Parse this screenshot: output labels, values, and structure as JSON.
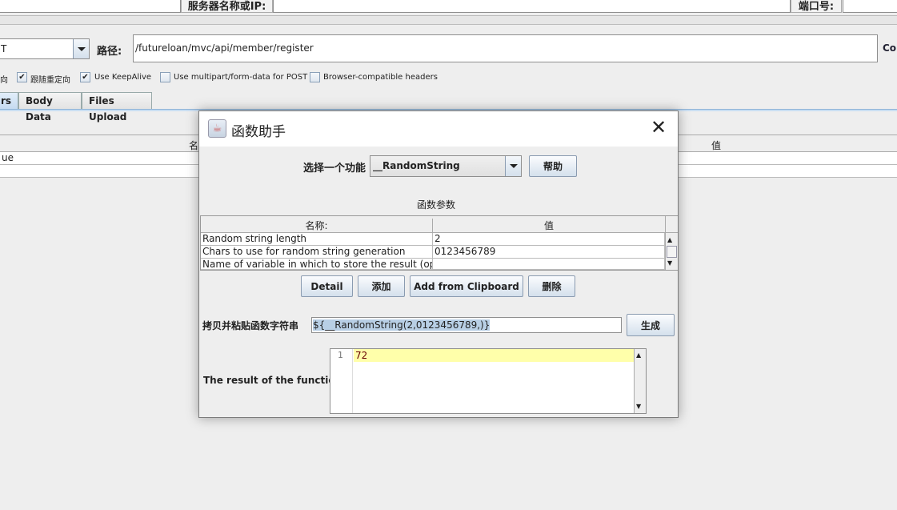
{
  "top": {
    "server_label": "服务器名称或IP:",
    "port_label": "端口号:",
    "server_value": "",
    "port_value": ""
  },
  "request": {
    "method_value": "T",
    "path_label": "路径:",
    "path_value": "/futureloan/mvc/api/member/register",
    "content_label_partial": "Cor"
  },
  "options": [
    {
      "label": "向",
      "checked": null
    },
    {
      "label": "跟随重定向",
      "checked": true
    },
    {
      "label": "Use KeepAlive",
      "checked": true
    },
    {
      "label": "Use multipart/form-data for POST",
      "checked": false
    },
    {
      "label": "Browser-compatible headers",
      "checked": false
    }
  ],
  "tabs": [
    {
      "label": "rs",
      "selected": true
    },
    {
      "label": "Body Data",
      "selected": false
    },
    {
      "label": "Files Upload",
      "selected": false
    }
  ],
  "bg_table": {
    "col_name": "名",
    "col_value": "值",
    "rows": [
      "ue",
      ""
    ]
  },
  "dialog": {
    "title": "函数助手",
    "select_label": "选择一个功能",
    "function_value": "__RandomString",
    "help_button": "帮助",
    "params_title": "函数参数",
    "table": {
      "headers": [
        "名称:",
        "值"
      ],
      "rows": [
        [
          "Random string length",
          "2"
        ],
        [
          "Chars to use for random string generation",
          "0123456789"
        ],
        [
          "Name of variable in which to store the result (optio...",
          ""
        ]
      ]
    },
    "buttons": [
      "Detail",
      "添加",
      "Add from Clipboard",
      "删除"
    ],
    "copy_label": "拷贝并粘贴函数字符串",
    "function_string": "${__RandomString(2,0123456789,)}",
    "generate_button": "生成",
    "result_label": "The result of the function is",
    "result_line_number": "1",
    "result_value": "72"
  },
  "colors": {
    "background": "#eeeeee",
    "selection": "#b8cfe5",
    "current_line": "#ffffaa",
    "tab_selected": "#c9def2"
  }
}
